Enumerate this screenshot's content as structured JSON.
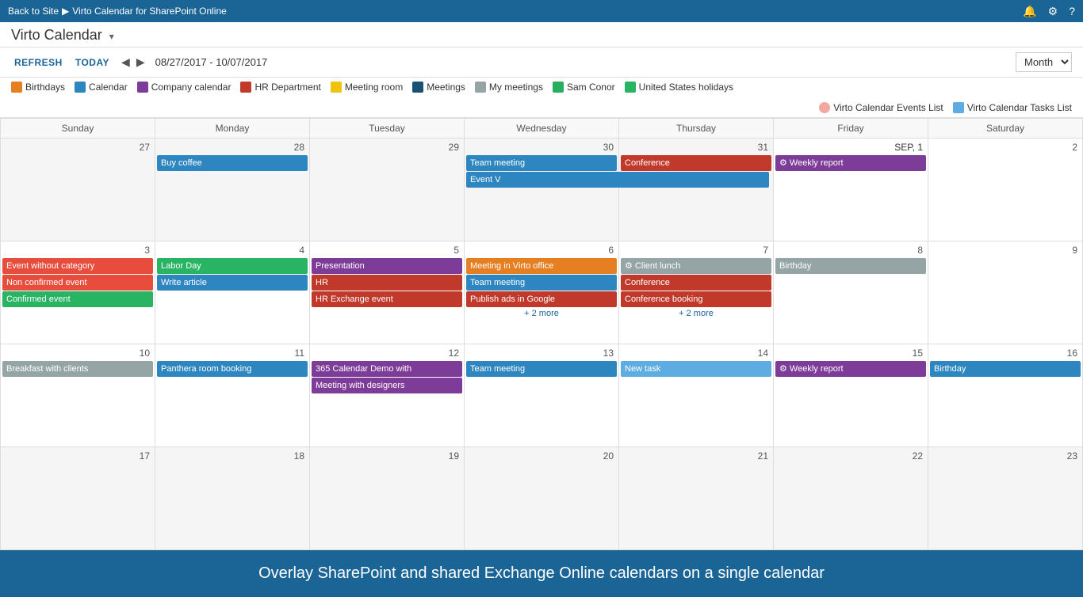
{
  "topbar": {
    "back_label": "Back to Site",
    "sep": "▶",
    "page_title": "Virto Calendar for SharePoint Online",
    "bell_icon": "🔔",
    "gear_icon": "⚙",
    "help_icon": "?"
  },
  "app": {
    "title": "Virto Calendar",
    "caret": "▾"
  },
  "toolbar": {
    "refresh": "REFRESH",
    "today": "TODAY",
    "prev": "◀",
    "next": "▶",
    "date_range": "08/27/2017 - 10/07/2017",
    "view": "Month"
  },
  "legend": [
    {
      "id": "birthdays",
      "label": "Birthdays",
      "color": "#e67e22"
    },
    {
      "id": "calendar",
      "label": "Calendar",
      "color": "#2e86c1"
    },
    {
      "id": "company",
      "label": "Company calendar",
      "color": "#7d3c98"
    },
    {
      "id": "hr",
      "label": "HR Department",
      "color": "#c0392b"
    },
    {
      "id": "meeting-room",
      "label": "Meeting room",
      "color": "#f0c30f"
    },
    {
      "id": "meetings",
      "label": "Meetings",
      "color": "#1a5276"
    },
    {
      "id": "my-meetings",
      "label": "My meetings",
      "color": "#95a5a6"
    },
    {
      "id": "sam",
      "label": "Sam Conor",
      "color": "#27ae60"
    },
    {
      "id": "us-holidays",
      "label": "United States holidays",
      "color": "#28b463"
    },
    {
      "id": "events-list",
      "label": "Virto Calendar Events List",
      "color": "#f1a9a0"
    },
    {
      "id": "tasks-list",
      "label": "Virto Calendar Tasks List",
      "color": "#5dade2"
    }
  ],
  "headers": [
    "Sunday",
    "Monday",
    "Tuesday",
    "Wednesday",
    "Thursday",
    "Friday",
    "Saturday"
  ],
  "weeks": [
    {
      "days": [
        {
          "num": "27",
          "other": true,
          "events": []
        },
        {
          "num": "28",
          "other": true,
          "events": [
            {
              "label": "Buy coffee",
              "color": "#2e86c1"
            }
          ]
        },
        {
          "num": "29",
          "other": true,
          "events": []
        },
        {
          "num": "30",
          "other": true,
          "events": [
            {
              "label": "Team meeting",
              "color": "#2e86c1"
            },
            {
              "label": "Event V",
              "color": "#2e86c1",
              "span": true
            }
          ]
        },
        {
          "num": "31",
          "other": true,
          "events": [
            {
              "label": "Conference",
              "color": "#c0392b"
            }
          ]
        },
        {
          "num": "SEP, 1",
          "sep": true,
          "events": [
            {
              "label": "⚙ Weekly report",
              "color": "#7d3c98"
            }
          ]
        },
        {
          "num": "2",
          "events": []
        }
      ]
    },
    {
      "days": [
        {
          "num": "3",
          "events": [
            {
              "label": "Event without category",
              "color": "#e74c3c"
            },
            {
              "label": "Non confirmed event",
              "color": "#e74c3c"
            },
            {
              "label": "Confirmed event",
              "color": "#28b463"
            }
          ]
        },
        {
          "num": "4",
          "events": [
            {
              "label": "Labor Day",
              "color": "#28b463"
            },
            {
              "label": "Write article",
              "color": "#2e86c1"
            }
          ]
        },
        {
          "num": "5",
          "events": [
            {
              "label": "Presentation",
              "color": "#7d3c98"
            },
            {
              "label": "HR",
              "color": "#c0392b"
            },
            {
              "label": "HR Exchange event",
              "color": "#c0392b"
            }
          ]
        },
        {
          "num": "6",
          "events": [
            {
              "label": "Meeting in Virto office",
              "color": "#e67e22"
            },
            {
              "label": "Team meeting",
              "color": "#2e86c1"
            },
            {
              "label": "Publish ads in Google",
              "color": "#c0392b"
            },
            {
              "more": "+ 2 more"
            }
          ]
        },
        {
          "num": "7",
          "events": [
            {
              "label": "⚙ Client lunch",
              "color": "#95a5a6"
            },
            {
              "label": "Conference",
              "color": "#c0392b"
            },
            {
              "label": "Conference booking",
              "color": "#c0392b"
            },
            {
              "more": "+ 2 more"
            }
          ]
        },
        {
          "num": "8",
          "events": [
            {
              "label": "Birthday",
              "color": "#95a5a6"
            }
          ]
        },
        {
          "num": "9",
          "events": []
        }
      ]
    },
    {
      "days": [
        {
          "num": "10",
          "events": [
            {
              "label": "Breakfast with clients",
              "color": "#95a5a6"
            }
          ]
        },
        {
          "num": "11",
          "events": [
            {
              "label": "Panthera room booking",
              "color": "#2e86c1"
            }
          ]
        },
        {
          "num": "12",
          "events": [
            {
              "label": "365 Calendar Demo with",
              "color": "#7d3c98"
            },
            {
              "label": "Meeting with designers",
              "color": "#7d3c98"
            }
          ]
        },
        {
          "num": "13",
          "events": [
            {
              "label": "Team meeting",
              "color": "#2e86c1"
            }
          ]
        },
        {
          "num": "14",
          "events": [
            {
              "label": "New task",
              "color": "#5dade2"
            }
          ]
        },
        {
          "num": "15",
          "events": [
            {
              "label": "⚙ Weekly report",
              "color": "#7d3c98"
            }
          ]
        },
        {
          "num": "16",
          "events": [
            {
              "label": "Birthday",
              "color": "#2e86c1"
            }
          ]
        }
      ]
    },
    {
      "days": [
        {
          "num": "17",
          "partial": true,
          "events": []
        },
        {
          "num": "18",
          "partial": true,
          "events": []
        },
        {
          "num": "19",
          "partial": true,
          "events": []
        },
        {
          "num": "20",
          "partial": true,
          "events": []
        },
        {
          "num": "21",
          "partial": true,
          "events": []
        },
        {
          "num": "22",
          "partial": true,
          "events": []
        },
        {
          "num": "23",
          "partial": true,
          "events": []
        }
      ]
    }
  ],
  "footer": {
    "text": "Overlay SharePoint and shared Exchange Online calendars on a single calendar"
  }
}
